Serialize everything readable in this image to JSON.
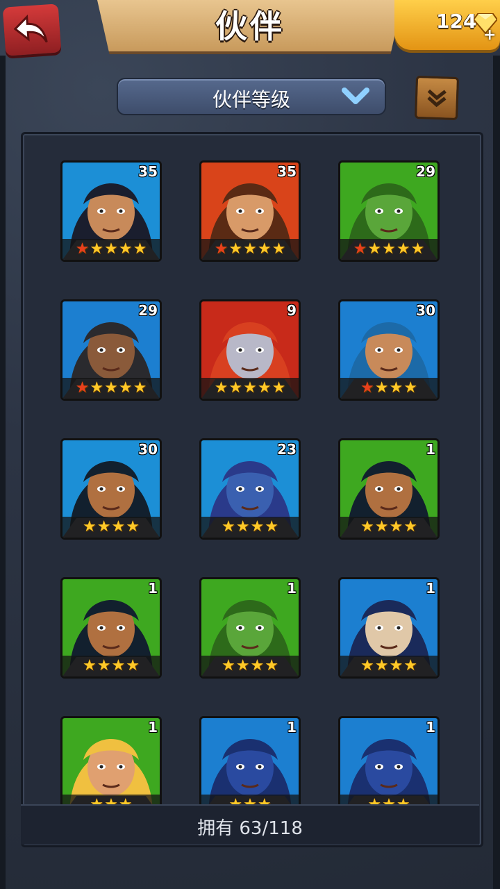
{
  "header": {
    "title": "伙伴",
    "currency": "124"
  },
  "filter": {
    "label": "伙伴等级"
  },
  "cards": [
    {
      "level": "35",
      "stars": 5,
      "red_stars": 1,
      "bg": "#1c8fd6",
      "skin": "#c88a5a",
      "hair": "#1a1e2e"
    },
    {
      "level": "35",
      "stars": 5,
      "red_stars": 1,
      "bg": "#d9441a",
      "skin": "#d89a68",
      "hair": "#5a2a14"
    },
    {
      "level": "29",
      "stars": 5,
      "red_stars": 1,
      "bg": "#3ea820",
      "skin": "#5aa63a",
      "hair": "#2d6a1a"
    },
    {
      "level": "29",
      "stars": 5,
      "red_stars": 1,
      "bg": "#1c7fd0",
      "skin": "#8a5a3a",
      "hair": "#2a2a2e"
    },
    {
      "level": "9",
      "stars": 5,
      "red_stars": 0,
      "bg": "#c82a1a",
      "skin": "#b8b8c8",
      "hair": "#d84020"
    },
    {
      "level": "30",
      "stars": 4,
      "red_stars": 1,
      "bg": "#1c7fd0",
      "skin": "#c88a5a",
      "hair": "#1c6aa8"
    },
    {
      "level": "30",
      "stars": 4,
      "red_stars": 0,
      "bg": "#1c8fd6",
      "skin": "#b07040",
      "hair": "#12202e"
    },
    {
      "level": "23",
      "stars": 4,
      "red_stars": 0,
      "bg": "#1c8fd6",
      "skin": "#3a60b0",
      "hair": "#2a3a8a"
    },
    {
      "level": "1",
      "stars": 4,
      "red_stars": 0,
      "bg": "#3ea820",
      "skin": "#b07040",
      "hair": "#12202e"
    },
    {
      "level": "1",
      "stars": 4,
      "red_stars": 0,
      "bg": "#3ea820",
      "skin": "#b07040",
      "hair": "#12202e"
    },
    {
      "level": "1",
      "stars": 4,
      "red_stars": 0,
      "bg": "#3ea820",
      "skin": "#5aa63a",
      "hair": "#2d6a1a"
    },
    {
      "level": "1",
      "stars": 4,
      "red_stars": 0,
      "bg": "#1c7fd0",
      "skin": "#e0c8a8",
      "hair": "#1a2a5a"
    },
    {
      "level": "1",
      "stars": 3,
      "red_stars": 0,
      "bg": "#3ea820",
      "skin": "#e0a070",
      "hair": "#f0c040"
    },
    {
      "level": "1",
      "stars": 3,
      "red_stars": 0,
      "bg": "#1c7fd0",
      "skin": "#2a4aa0",
      "hair": "#1a3070"
    },
    {
      "level": "1",
      "stars": 3,
      "red_stars": 0,
      "bg": "#1c7fd0",
      "skin": "#2a4aa0",
      "hair": "#1a3070"
    }
  ],
  "footer": {
    "text": "拥有 63/118"
  }
}
